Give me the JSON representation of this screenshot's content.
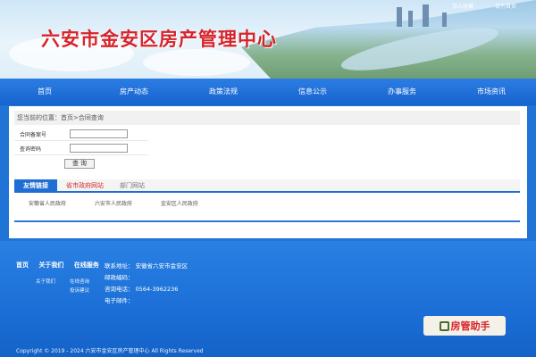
{
  "header": {
    "title": "六安市金安区房产管理中心",
    "top_links": [
      "加入收藏",
      "设为首页"
    ]
  },
  "nav": {
    "items": [
      "首页",
      "房产动态",
      "政策法规",
      "信息公示",
      "办事服务",
      "市场资讯"
    ]
  },
  "breadcrumb": "您当前的位置：首页>合同查询",
  "form": {
    "contract_no_label": "合同备案号",
    "password_label": "查询密码",
    "contract_no_value": "",
    "password_value": "",
    "query_button": "查 询"
  },
  "links": {
    "tabs": [
      "友情链接",
      "省市政府网站",
      "部门网站"
    ],
    "items": [
      "安徽省人民政府",
      "六安市人民政府",
      "金安区人民政府"
    ]
  },
  "footer": {
    "nav": [
      "首页",
      "关于我们",
      "在线服务"
    ],
    "about_sub": "关于我们",
    "service_sub": [
      "在线咨询",
      "投诉建议"
    ],
    "address": "联系地址：  安徽省六安市金安区",
    "postcode": "邮政编码：",
    "phone": "咨询电话：  0564-3962236",
    "email": "电子邮件：",
    "watermark": "房管助手",
    "copyright": "Copyright © 2019 - 2024 六安市金安区房产管理中心 All Rights Reserved"
  },
  "colors": {
    "title_red": "#d8232a",
    "nav_blue": "#1664cf",
    "footer_blue": "#1b6fd6"
  }
}
